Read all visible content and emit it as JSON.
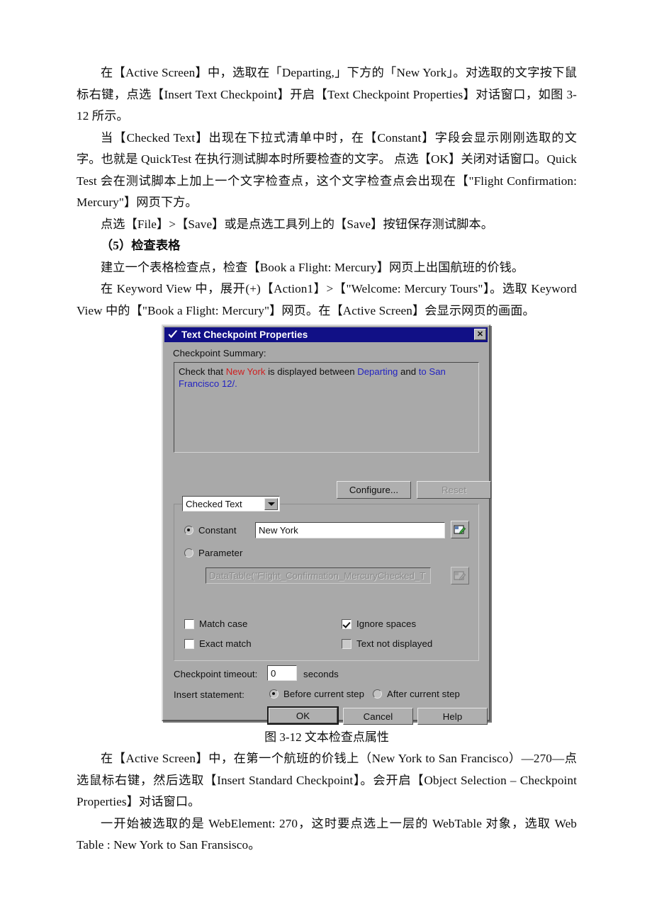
{
  "document": {
    "paragraphs": [
      "在【Active Screen】中，选取在「Departing,」下方的「New York」。对选取的文字按下鼠标右键，点选【Insert Text Checkpoint】开启【Text Checkpoint Properties】对话窗口，如图 3-12 所示。",
      "当【Checked Text】出现在下拉式清单中时，在【Constant】字段会显示刚刚选取的文字。也就是 QuickTest 在执行测试脚本时所要检查的文字。 点选【OK】关闭对话窗口。Quick Test 会在测试脚本上加上一个文字检查点，这个文字检查点会出现在【\"Flight Confirmation: Mercury\"】网页下方。",
      "点选【File】>【Save】或是点选工具列上的【Save】按钮保存测试脚本。"
    ],
    "section_heading": "（5）检查表格",
    "paragraphs_after_heading": [
      "建立一个表格检查点，检查【Book a Flight: Mercury】网页上出国航班的价钱。",
      "在 Keyword View 中，展开(+)【Action1】>【\"Welcome: Mercury Tours\"】。选取 Keyword View 中的【\"Book a Flight: Mercury\"】网页。在【Active Screen】会显示网页的画面。"
    ],
    "figure_caption": "图 3-12  文本检查点属性",
    "paragraphs_after_figure": [
      "在【Active Screen】中，在第一个航班的价钱上（New York to San Francisco）—270—点选鼠标右键，然后选取【Insert Standard Checkpoint】。会开启【Object Selection – Checkpoint Properties】对话窗口。",
      "一开始被选取的是 WebElement: 270，这时要点选上一层的 WebTable 对象，选取 Web Table : New York to San Fransisco。"
    ]
  },
  "dialog": {
    "title": "Text Checkpoint Properties",
    "title_icon": "checkmark-icon",
    "close_label": "✕",
    "titlebar_color": "#13128c",
    "face_color": "#a8a8a8",
    "summary": {
      "label": "Checkpoint Summary:",
      "segments": [
        {
          "text": "Check that ",
          "color": "#111111"
        },
        {
          "text": "New York",
          "color": "#d42020"
        },
        {
          "text": " is  displayed between ",
          "color": "#111111"
        },
        {
          "text": "Departing",
          "color": "#2424c8"
        },
        {
          "text": " and ",
          "color": "#111111"
        },
        {
          "text": " to San Francisco 12/.",
          "color": "#2424c8"
        }
      ],
      "plain_text": "Check that New York is  displayed between Departing and  to San Francisco 12/."
    },
    "buttons": {
      "configure": "Configure...",
      "reset": "Reset",
      "ok": "OK",
      "cancel": "Cancel",
      "help": "Help"
    },
    "property_select": {
      "value": "Checked Text",
      "options": [
        "Checked Text"
      ]
    },
    "constant": {
      "radio_label": "Constant",
      "selected": true,
      "value": "New York"
    },
    "parameter": {
      "radio_label": "Parameter",
      "selected": false,
      "value": "DataTable(\"Flight_Confirmation_MercuryChecked_T",
      "enabled": false
    },
    "checkboxes": [
      {
        "label": "Match case",
        "checked": false
      },
      {
        "label": "Ignore spaces",
        "checked": true
      },
      {
        "label": "Exact match",
        "checked": false
      },
      {
        "label": "Text not displayed",
        "checked": false
      }
    ],
    "timeout": {
      "label": "Checkpoint timeout:",
      "value": "0",
      "units": "seconds"
    },
    "insert_statement": {
      "label": "Insert statement:",
      "options": [
        {
          "label": "Before current step",
          "selected": true
        },
        {
          "label": "After current step",
          "selected": false
        }
      ]
    }
  }
}
